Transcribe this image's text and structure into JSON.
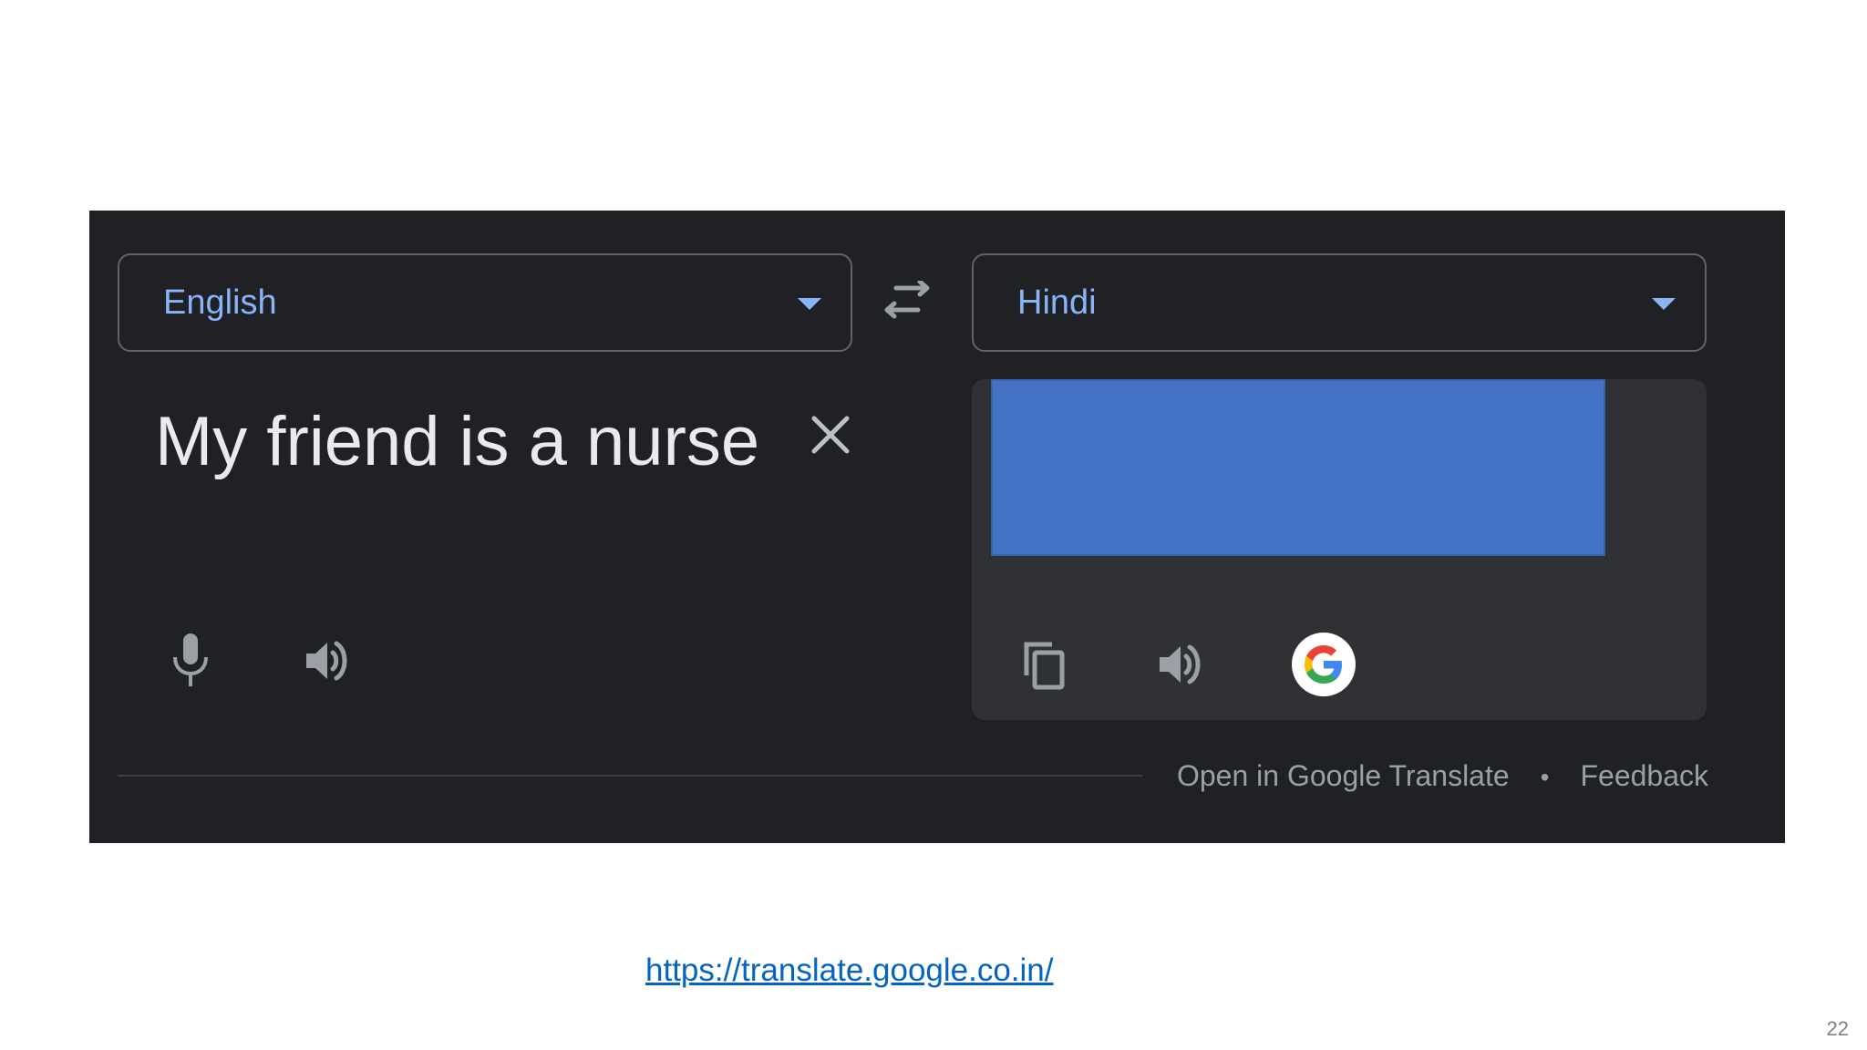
{
  "widget": {
    "source_language": "English",
    "target_language": "Hindi",
    "source_text": "My friend is a nurse",
    "footer": {
      "open_link": "Open in Google Translate",
      "separator": "•",
      "feedback": "Feedback"
    },
    "icons": {
      "swap": "swap-languages-icon",
      "clear": "close-icon",
      "mic": "microphone-icon",
      "listen": "speaker-icon",
      "copy": "copy-icon",
      "google": "google-logo-icon"
    }
  },
  "slide": {
    "url": "https://translate.google.co.in/",
    "page_number": "22"
  },
  "colors": {
    "panel_bg": "#202124",
    "accent": "#8ab4f8",
    "redaction": "#4472c4",
    "link": "#0563c1"
  }
}
